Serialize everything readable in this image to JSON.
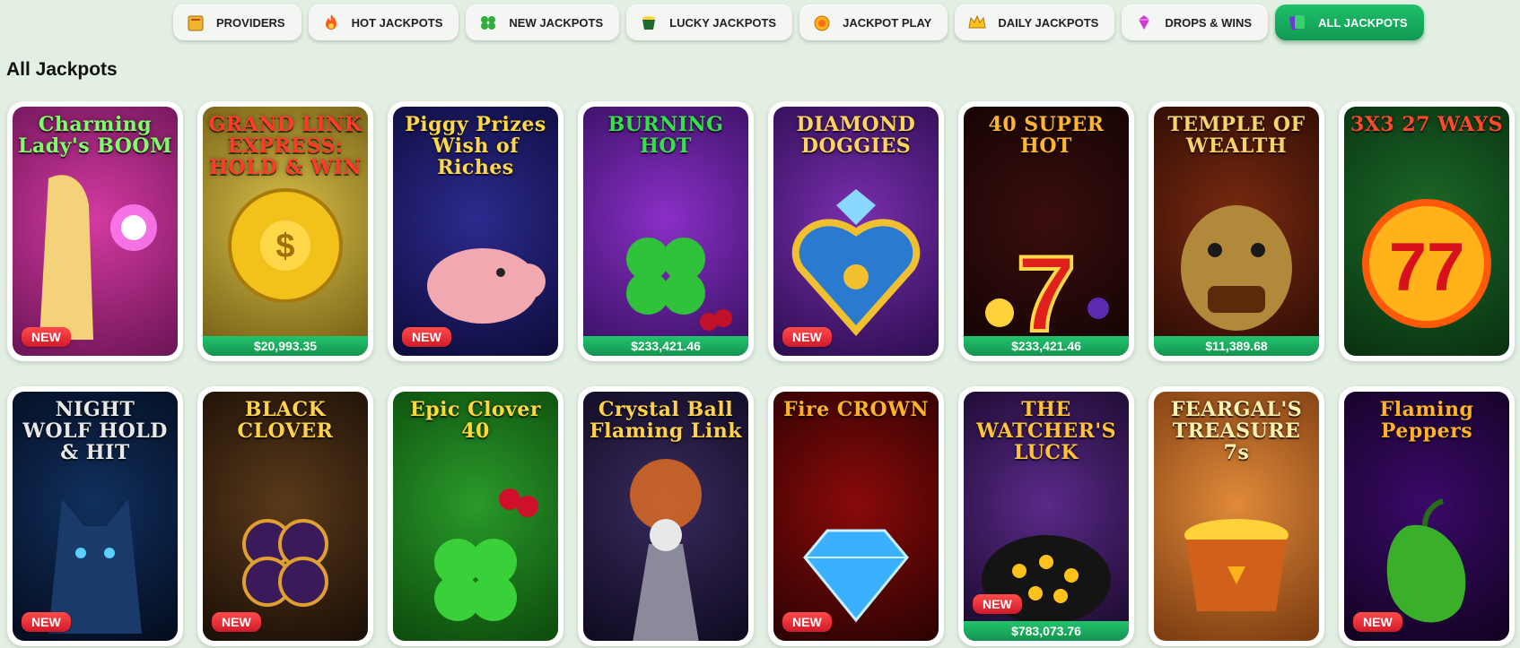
{
  "tabs": [
    {
      "label": "PROVIDERS",
      "icon": "book-icon",
      "name": "tab-providers",
      "active": false
    },
    {
      "label": "HOT JACKPOTS",
      "icon": "flame-icon",
      "name": "tab-hot-jackpots",
      "active": false
    },
    {
      "label": "NEW JACKPOTS",
      "icon": "clover-icon",
      "name": "tab-new-jackpots",
      "active": false
    },
    {
      "label": "LUCKY JACKPOTS",
      "icon": "pot-of-gold-icon",
      "name": "tab-lucky-jackpots",
      "active": false
    },
    {
      "label": "JACKPOT PLAY",
      "icon": "coin-icon",
      "name": "tab-jackpot-play",
      "active": false
    },
    {
      "label": "DAILY JACKPOTS",
      "icon": "crown-icon",
      "name": "tab-daily-jackpots",
      "active": false
    },
    {
      "label": "DROPS & WINS",
      "icon": "gem-icon",
      "name": "tab-drops-wins",
      "active": false
    },
    {
      "label": "ALL JACKPOTS",
      "icon": "cards-icon",
      "name": "tab-all-jackpots",
      "active": true
    }
  ],
  "section_title": "All Jackpots",
  "colors": {
    "accent": "#17a85c",
    "new_badge": "#e0212f",
    "background": "#e3efe3"
  },
  "games": [
    {
      "title": "Charming Lady's BOOM",
      "badge": "NEW",
      "jackpot": "",
      "palette": [
        "#d43aa0",
        "#6b1456"
      ],
      "title_color": "#7dff6a",
      "motif": "orb-icon"
    },
    {
      "title": "GRAND LINK EXPRESS: HOLD & WIN",
      "badge": "",
      "jackpot": "$20,993.35",
      "palette": [
        "#d9c04a",
        "#6e5a12"
      ],
      "title_color": "#ff3b2a",
      "motif": "gold-train-icon"
    },
    {
      "title": "Piggy Prizes Wish of Riches",
      "badge": "NEW",
      "jackpot": "",
      "palette": [
        "#2d2a8e",
        "#0d0c3a"
      ],
      "title_color": "#ffd84a",
      "motif": "piggy-icon"
    },
    {
      "title": "BURNING HOT",
      "badge": "",
      "jackpot": "$233,421.46",
      "palette": [
        "#8a2fc7",
        "#35105e"
      ],
      "title_color": "#35e04a",
      "motif": "clover-icon"
    },
    {
      "title": "DIAMOND DOGGIES",
      "badge": "NEW",
      "jackpot": "",
      "palette": [
        "#7a2fb0",
        "#2c0d4f"
      ],
      "title_color": "#ffd45e",
      "motif": "paw-heart-icon"
    },
    {
      "title": "40 SUPER HOT",
      "badge": "",
      "jackpot": "$233,421.46",
      "palette": [
        "#3a0d0d",
        "#120404"
      ],
      "title_color": "#ffb52e",
      "motif": "seven-icon"
    },
    {
      "title": "TEMPLE OF WEALTH",
      "badge": "",
      "jackpot": "$11,389.68",
      "palette": [
        "#7a2a10",
        "#2a0b04"
      ],
      "title_color": "#f7d36a",
      "motif": "dragon-icon"
    },
    {
      "title": "3X3 27 WAYS",
      "badge": "",
      "jackpot": "",
      "palette": [
        "#1d6a2a",
        "#08300f"
      ],
      "title_color": "#ff4a2a",
      "motif": "double-seven-icon"
    },
    {
      "title": "NIGHT WOLF HOLD & HIT",
      "badge": "NEW",
      "jackpot": "",
      "palette": [
        "#10305e",
        "#040c1e"
      ],
      "title_color": "#e8e8e8",
      "motif": "wolf-icon"
    },
    {
      "title": "BLACK CLOVER",
      "badge": "NEW",
      "jackpot": "",
      "palette": [
        "#5a3a1a",
        "#1a0e06"
      ],
      "title_color": "#ffd24a",
      "motif": "black-clover-icon"
    },
    {
      "title": "Epic Clover 40",
      "badge": "",
      "jackpot": "",
      "palette": [
        "#2a9a2a",
        "#0c4a0c"
      ],
      "title_color": "#ffd93a",
      "motif": "cherry-clover-icon"
    },
    {
      "title": "Crystal Ball Flaming Link",
      "badge": "",
      "jackpot": "",
      "palette": [
        "#3a2a5e",
        "#0e0a20"
      ],
      "title_color": "#ffd24a",
      "motif": "wizard-icon"
    },
    {
      "title": "Fire CROWN",
      "badge": "NEW",
      "jackpot": "",
      "palette": [
        "#8a0a0a",
        "#2a0202"
      ],
      "title_color": "#ffb12a",
      "motif": "diamond-icon"
    },
    {
      "title": "THE WATCHER'S LUCK",
      "badge": "NEW",
      "jackpot": "$783,073.76",
      "palette": [
        "#5a2a8a",
        "#180828"
      ],
      "title_color": "#ffc23a",
      "motif": "eyes-icon"
    },
    {
      "title": "FEARGAL'S TREASURE 7s",
      "badge": "",
      "jackpot": "",
      "palette": [
        "#e08a3a",
        "#7a3a10"
      ],
      "title_color": "#fff1b0",
      "motif": "pot-of-gold-icon"
    },
    {
      "title": "Flaming Peppers",
      "badge": "NEW",
      "jackpot": "",
      "palette": [
        "#3a0a6a",
        "#120220"
      ],
      "title_color": "#ffb22a",
      "motif": "pepper-icon"
    }
  ]
}
